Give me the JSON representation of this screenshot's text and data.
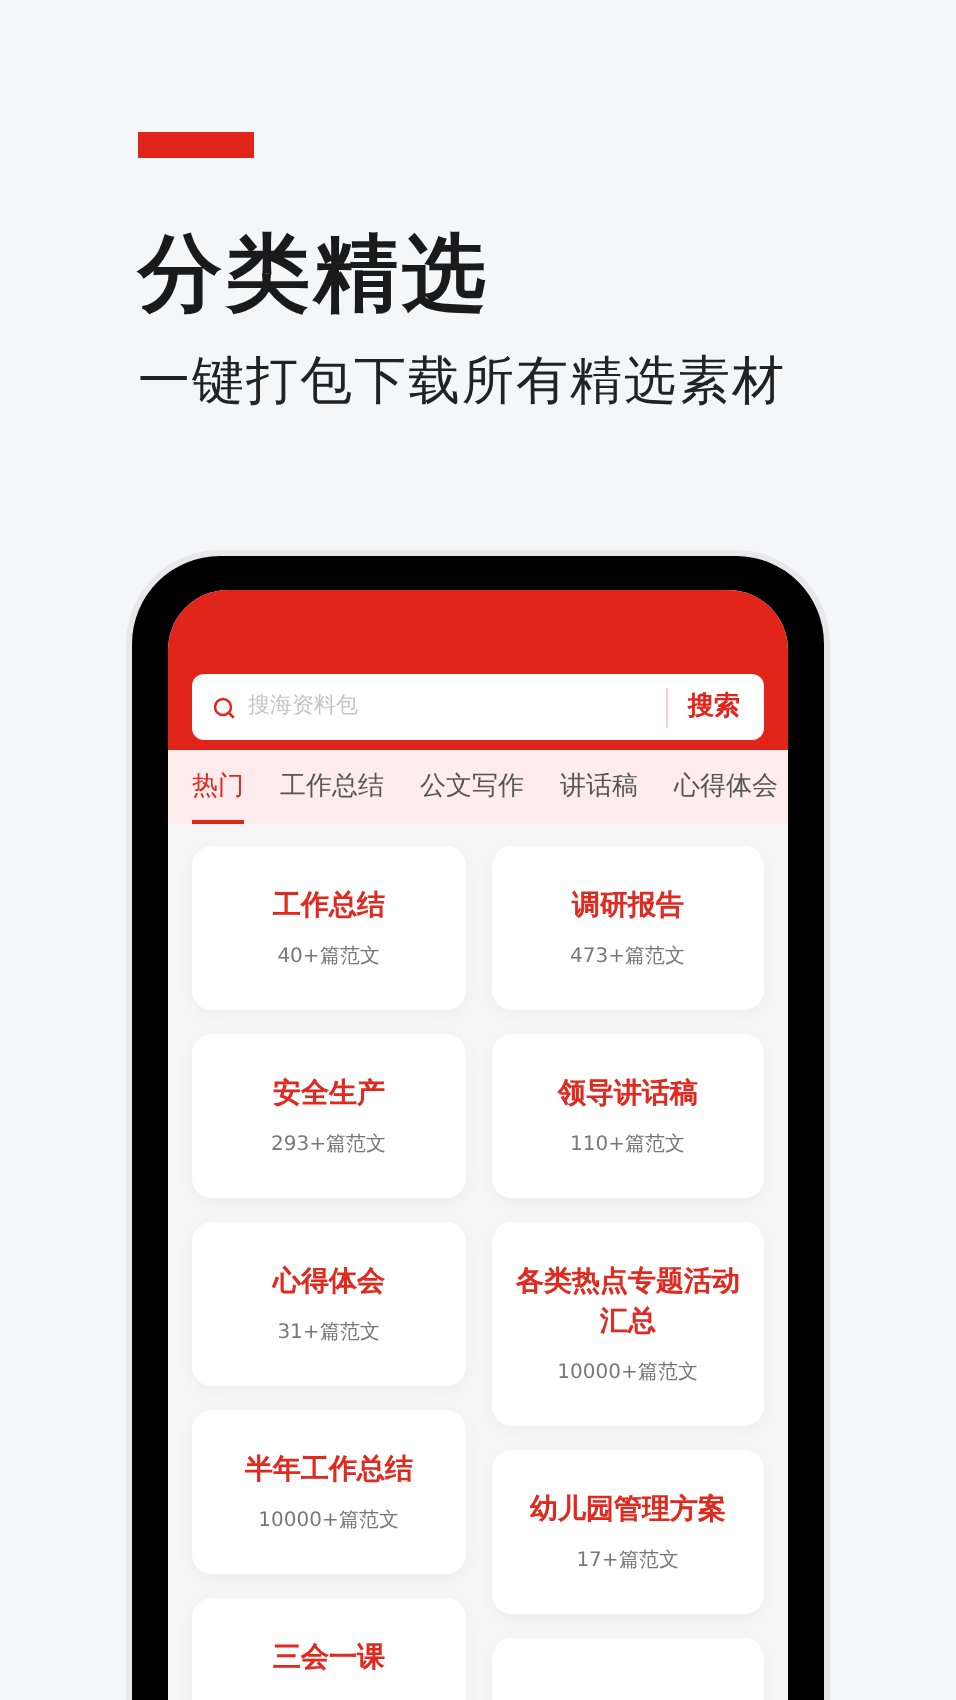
{
  "headline": {
    "title": "分类精选",
    "subtitle": "一键打包下载所有精选素材"
  },
  "search": {
    "placeholder": "搜海资料包",
    "button": "搜索"
  },
  "tabs": [
    {
      "label": "热门",
      "selected": true
    },
    {
      "label": "工作总结",
      "selected": false
    },
    {
      "label": "公文写作",
      "selected": false
    },
    {
      "label": "讲话稿",
      "selected": false
    },
    {
      "label": "心得体会",
      "selected": false
    }
  ],
  "card_columns": [
    {
      "cards": [
        {
          "kind": "category",
          "title": "工作总结",
          "count": "40+篇范文"
        },
        {
          "kind": "category",
          "title": "安全生产",
          "count": "293+篇范文"
        },
        {
          "kind": "category",
          "title": "心得体会",
          "count": "31+篇范文"
        },
        {
          "kind": "category",
          "title": "半年工作总结",
          "count": "10000+篇范文"
        },
        {
          "kind": "title_only",
          "title": "三会一课"
        }
      ]
    },
    {
      "cards": [
        {
          "kind": "category",
          "title": "调研报告",
          "count": "473+篇范文"
        },
        {
          "kind": "category",
          "title": "领导讲话稿",
          "count": "110+篇范文"
        },
        {
          "kind": "category",
          "title": "各类热点专题活动汇总",
          "count": "10000+篇范文"
        },
        {
          "kind": "category",
          "title": "幼儿园管理方案",
          "count": "17+篇范文"
        },
        {
          "kind": "empty"
        }
      ]
    }
  ]
}
